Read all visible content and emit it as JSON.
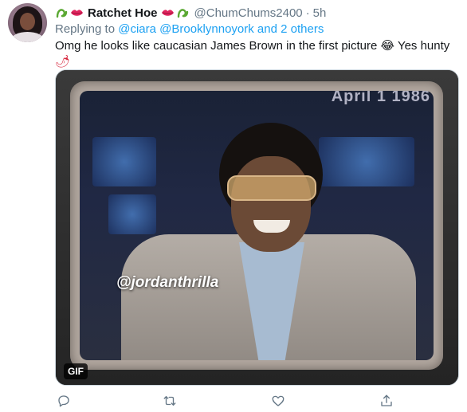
{
  "tweet": {
    "display_name": "Ratchet Hoe",
    "handle": "@ChumChums2400",
    "separator": "·",
    "time": "5h",
    "reply_prefix": "Replying to",
    "reply_mention_1": "@ciara",
    "reply_mention_2": "@Brooklynnoyork",
    "reply_and": "and",
    "reply_others": "2 others",
    "text_main": "Omg he looks like caucasian James Brown in the first picture",
    "text_emoji_laugh": "😂",
    "text_tail": "Yes hunty",
    "text_emoji_pepper": "🌶",
    "media_badge": "GIF",
    "watermark": "@jordanthrilla",
    "corner_text": "April 1 1986",
    "icons": [
      "cactus-emoji-icon",
      "lips-emoji-icon",
      "reply-icon",
      "retweet-icon",
      "like-icon",
      "share-icon"
    ],
    "colors": {
      "link": "#1da1f2",
      "muted": "#657786",
      "text": "#14171a",
      "lips": "#e0245e",
      "cactus": "#5aa832"
    }
  }
}
